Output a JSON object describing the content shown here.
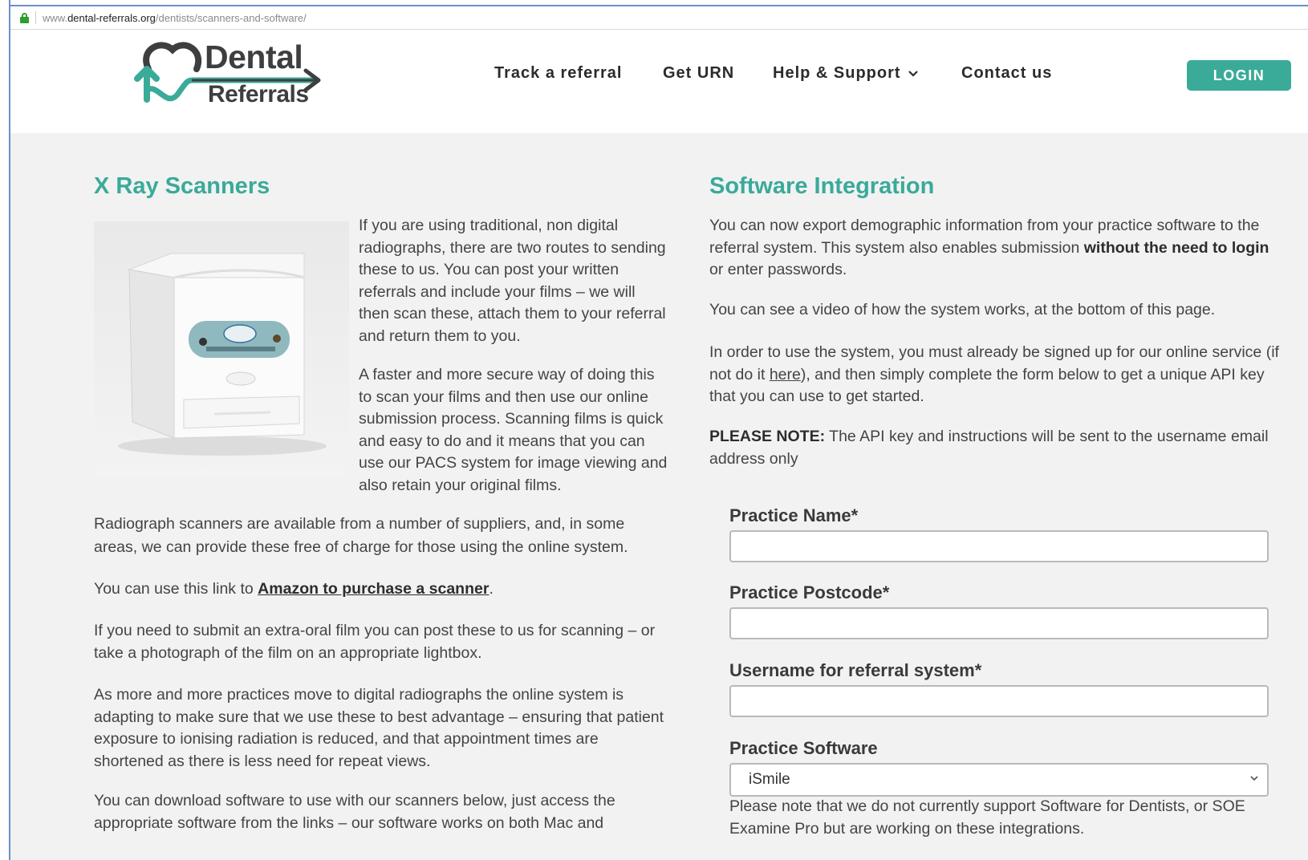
{
  "browser": {
    "url_prefix": "www.",
    "url_domain": "dental-referrals.org",
    "url_path": "/dentists/scanners-and-software/",
    "lock_icon": "lock-icon"
  },
  "header": {
    "logo_line1": "Dental",
    "logo_line2": "Referrals",
    "nav": {
      "track": "Track a referral",
      "urn": "Get URN",
      "help": "Help & Support",
      "contact": "Contact us"
    },
    "login": "LOGIN"
  },
  "left": {
    "title": "X Ray Scanners",
    "image_alt": "USB x-ray film reader",
    "p1": "If you are using traditional, non digital radiographs, there are two routes to sending these to us.  You can post your written referrals and include your films – we will then scan these, attach them to your referral and return them to you.",
    "p2": "A faster and more secure way of doing this to scan your films and then use our online submission process. Scanning films is quick and easy to do and it means that you can use our PACS system for image viewing and also retain your original films.",
    "p3": "Radiograph scanners are available from a number of suppliers, and, in some areas, we can provide these free of charge for those using the online system.",
    "p4_pre": "You can use this link to ",
    "p4_link": "Amazon to purchase a scanner",
    "p4_post": ".",
    "p5": "If you need to submit an extra-oral film you can post these to us for scanning – or take a photograph of the film on an appropriate lightbox.",
    "p6": "As more and more practices move to digital radiographs the online system is adapting to make sure that we use these to best advantage – ensuring that patient exposure to ionising radiation is reduced, and that appointment times are shortened as there is less need for repeat views.",
    "p7": "You can download software to use with our scanners below, just access the appropriate software from the links – our software works on both Mac and"
  },
  "right": {
    "title": "Software Integration",
    "p1_pre": "You can now export demographic information from your practice software to the referral system.  This system also enables submission ",
    "p1_bold": "without the need to login",
    "p1_post": " or enter passwords.",
    "p2": "You can see a video of how the system works, at the bottom of this page.",
    "p3_pre": "In order to use the system, you must already be signed up for our online service (if not do it ",
    "p3_link": "here",
    "p3_post": "), and then simply complete the form below to get a unique API key that you can use to get started.",
    "p4_bold": "PLEASE NOTE:",
    "p4_post": " The API key and instructions will be sent to the username email address only",
    "form": {
      "practice_name_label": "Practice Name*",
      "practice_name_value": "",
      "postcode_label": "Practice Postcode*",
      "postcode_value": "",
      "username_label": "Username for referral system*",
      "username_value": "",
      "software_label": "Practice Software",
      "software_selected": "iSmile",
      "note": "Please note that we do not currently support Software for Dentists, or SOE Examine Pro but are working on these integrations."
    }
  },
  "colors": {
    "accent": "#3aaa99",
    "page_bg": "#f2f2f2"
  }
}
